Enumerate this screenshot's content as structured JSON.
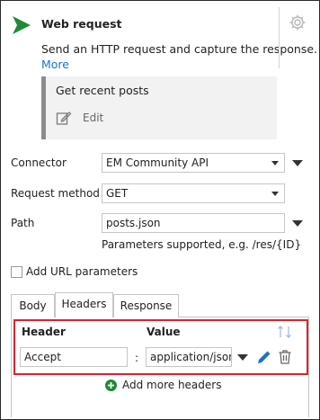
{
  "header": {
    "title": "Web request",
    "description": "Send an HTTP request and capture the response.",
    "more_link": "More"
  },
  "preview": {
    "title": "Get recent posts",
    "edit_label": "Edit"
  },
  "form": {
    "connector_label": "Connector",
    "connector_value": "EM Community API",
    "method_label": "Request method",
    "method_value": "GET",
    "path_label": "Path",
    "path_value": "posts.json",
    "path_hint": "Parameters supported, e.g. /res/{ID}",
    "url_params_label": "Add URL parameters"
  },
  "tabs": [
    {
      "label": "Body"
    },
    {
      "label": "Headers"
    },
    {
      "label": "Response"
    }
  ],
  "headers_table": {
    "col_header": "Header",
    "col_value": "Value",
    "rows": [
      {
        "header": "Accept",
        "separator": ":",
        "value": "application/json"
      }
    ],
    "add_more_label": "Add more headers"
  },
  "colors": {
    "accent_green": "#1f8a33",
    "link_blue": "#1a73c8",
    "highlight_red": "#d9232e"
  },
  "icons": [
    "play-icon",
    "gear-icon",
    "edit-icon",
    "sort-icon",
    "pencil-icon",
    "trash-icon",
    "add-circle-icon"
  ]
}
